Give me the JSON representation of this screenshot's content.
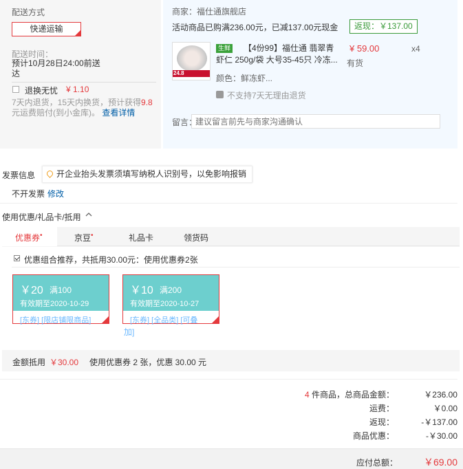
{
  "shipping": {
    "title": "配送方式",
    "method": "快递运输",
    "time_label": "配送时间：",
    "time_value": "预计10月28日24:00前送达",
    "return_label": "退换无忧",
    "return_price": "¥ 1.10",
    "return_desc_1": "7天内退货，15天内换货，预计获得",
    "return_desc_hl": "9.8",
    "return_desc_2": "元运费赔付(到小金库)。",
    "return_link": "查看详情"
  },
  "shop": {
    "name": "商家：福仕通旗舰店",
    "promo": "活动商品已购满236.00元，已减137.00元现金",
    "cashback": "返现：￥137.00",
    "product": {
      "badge": "生鲜",
      "title": "【4份99】福仕通 翡翠青虾仁 250g/袋 大号35-45只 冷冻...",
      "price": "¥ 59.00",
      "qty": "x4",
      "stock": "有货",
      "color": "颜色：鲜冻虾...",
      "no_return": "不支持7天无理由退货",
      "img_price": "24.8"
    },
    "message_label": "留言：",
    "message_placeholder": "建议留言前先与商家沟通确认"
  },
  "invoice": {
    "title": "发票信息",
    "tip": "开企业抬头发票须填写纳税人识别号，以免影响报销",
    "value": "不开发票",
    "edit": "修改"
  },
  "coupons": {
    "head": "使用优惠/礼品卡/抵用",
    "caret": "^",
    "tabs": [
      "优惠券",
      "京豆",
      "礼品卡",
      "领货码"
    ],
    "tab_dot": "•",
    "combo_text": "优惠组合推荐，共抵用30.00元：使用优惠券2张",
    "items": [
      {
        "amount": "￥20",
        "condition": "满100",
        "expiry": "有效期至2020-10-29",
        "tags": "[东券] [限店铺限商品]"
      },
      {
        "amount": "￥10",
        "condition": "满200",
        "expiry": "有效期至2020-10-27",
        "tags": "[东券] [全品类] [可叠",
        "tags_more": "加]"
      }
    ],
    "deduct_label": "金额抵用",
    "deduct_amount": "￥30.00",
    "deduct_desc": "使用优惠券 2 张，优惠 30.00 元"
  },
  "summary": {
    "count": "4",
    "count_suffix": " 件商品，总商品金额：",
    "total": "￥236.00",
    "freight_label": "运费：",
    "freight": "￥0.00",
    "cashback_label": "返现：",
    "cashback": "-￥137.00",
    "coupon_label": "商品优惠：",
    "coupon": "-￥30.00",
    "pay_label": "应付总额：",
    "pay": "￥69.00"
  }
}
